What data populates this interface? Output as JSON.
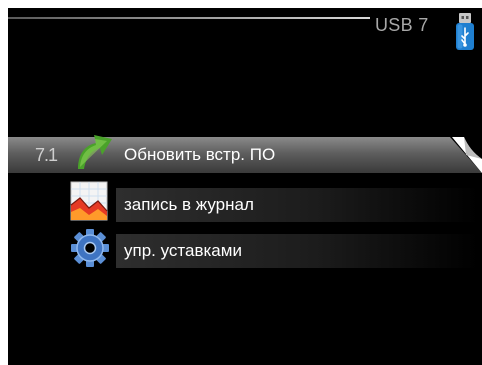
{
  "header": {
    "title": "USB 7",
    "icon": "usb-stick-icon"
  },
  "menu": {
    "items": [
      {
        "number": "7.1",
        "label": "Обновить встр. ПО",
        "icon": "update-arrow-icon",
        "selected": true
      },
      {
        "number": "",
        "label": "запись в журнал",
        "icon": "log-chart-icon",
        "selected": false
      },
      {
        "number": "",
        "label": "упр. уставками",
        "icon": "gear-icon",
        "selected": false
      }
    ]
  },
  "colors": {
    "background": "#000000",
    "text": "#ffffff",
    "title": "#a8a8a8",
    "selected_row": "#6e6e6e",
    "usb_blue": "#1f7fd0",
    "arrow_green": "#4aa22a"
  }
}
